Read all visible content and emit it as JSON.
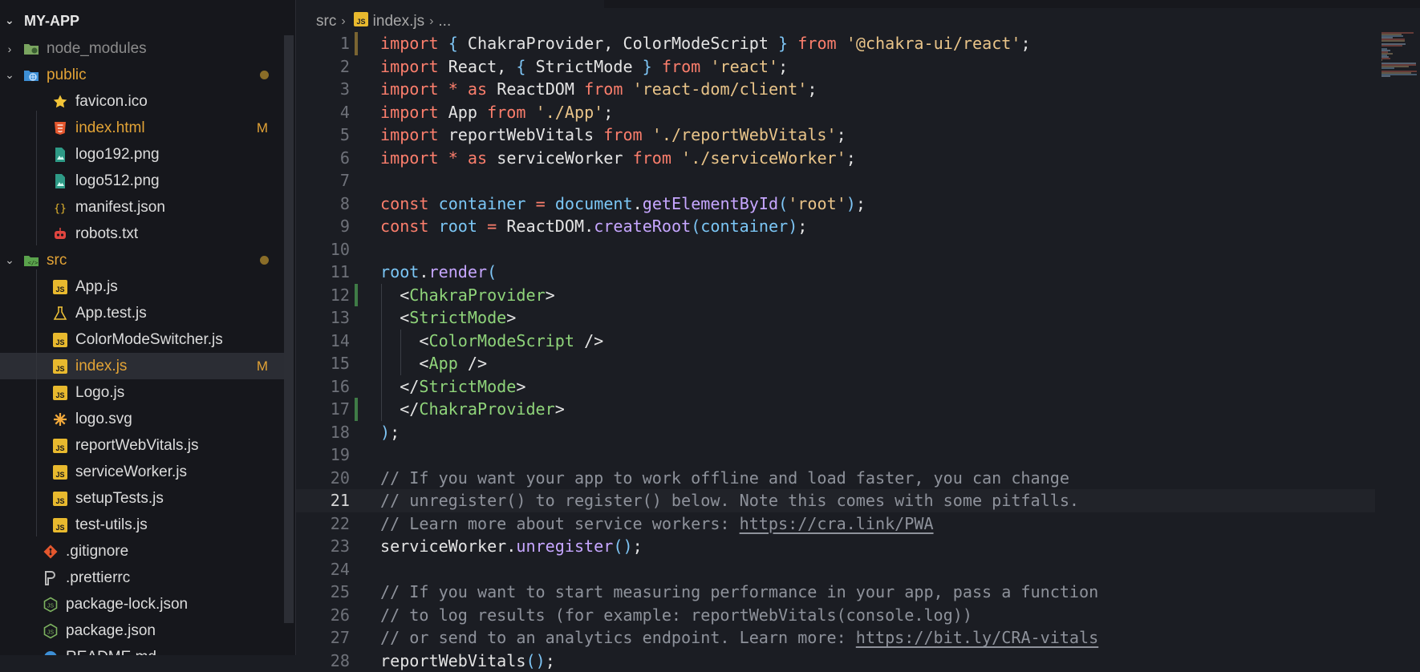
{
  "explorer": {
    "title": "MY-APP",
    "items": [
      {
        "name": "node_modules",
        "type": "folder",
        "icon": "folder-node-icon",
        "expanded": false,
        "depth": 0,
        "color": "#8c8c8c"
      },
      {
        "name": "public",
        "type": "folder",
        "icon": "folder-public-icon",
        "expanded": true,
        "depth": 0,
        "color": "#e2a336",
        "status": "dot"
      },
      {
        "name": "favicon.ico",
        "type": "file",
        "icon": "star-icon",
        "depth": 1
      },
      {
        "name": "index.html",
        "type": "file",
        "icon": "html-icon",
        "depth": 1,
        "color": "#e2a336",
        "status": "M"
      },
      {
        "name": "logo192.png",
        "type": "file",
        "icon": "image-icon",
        "depth": 1
      },
      {
        "name": "logo512.png",
        "type": "file",
        "icon": "image-icon",
        "depth": 1
      },
      {
        "name": "manifest.json",
        "type": "file",
        "icon": "json-icon",
        "depth": 1
      },
      {
        "name": "robots.txt",
        "type": "file",
        "icon": "robot-icon",
        "depth": 1
      },
      {
        "name": "src",
        "type": "folder",
        "icon": "folder-src-icon",
        "expanded": true,
        "depth": 0,
        "color": "#e2a336",
        "status": "dot"
      },
      {
        "name": "App.js",
        "type": "file",
        "icon": "js-icon",
        "depth": 1
      },
      {
        "name": "App.test.js",
        "type": "file",
        "icon": "test-flask-icon",
        "depth": 1
      },
      {
        "name": "ColorModeSwitcher.js",
        "type": "file",
        "icon": "js-icon",
        "depth": 1
      },
      {
        "name": "index.js",
        "type": "file",
        "icon": "js-icon",
        "depth": 1,
        "color": "#e2a336",
        "status": "M",
        "selected": true
      },
      {
        "name": "Logo.js",
        "type": "file",
        "icon": "js-icon",
        "depth": 1
      },
      {
        "name": "logo.svg",
        "type": "file",
        "icon": "svg-icon",
        "depth": 1
      },
      {
        "name": "reportWebVitals.js",
        "type": "file",
        "icon": "js-icon",
        "depth": 1
      },
      {
        "name": "serviceWorker.js",
        "type": "file",
        "icon": "js-icon",
        "depth": 1
      },
      {
        "name": "setupTests.js",
        "type": "file",
        "icon": "js-icon",
        "depth": 1
      },
      {
        "name": "test-utils.js",
        "type": "file",
        "icon": "js-icon",
        "depth": 1
      },
      {
        "name": ".gitignore",
        "type": "file",
        "icon": "git-icon",
        "depth": 0
      },
      {
        "name": ".prettierrc",
        "type": "file",
        "icon": "prettier-icon",
        "depth": 0
      },
      {
        "name": "package-lock.json",
        "type": "file",
        "icon": "nodejs-icon",
        "depth": 0
      },
      {
        "name": "package.json",
        "type": "file",
        "icon": "nodejs-icon",
        "depth": 0
      },
      {
        "name": "README.md",
        "type": "file",
        "icon": "info-icon",
        "depth": 0
      }
    ]
  },
  "breadcrumb": [
    "src",
    "index.js",
    "..."
  ],
  "editor": {
    "current_line": 21,
    "lines": [
      [
        [
          "k",
          "import"
        ],
        [
          "w",
          " "
        ],
        [
          "b",
          "{"
        ],
        [
          "w",
          " ChakraProvider, ColorModeScript "
        ],
        [
          "b",
          "}"
        ],
        [
          "w",
          " "
        ],
        [
          "k",
          "from"
        ],
        [
          "w",
          " "
        ],
        [
          "s",
          "'@chakra-ui/react'"
        ],
        [
          "w",
          ";"
        ]
      ],
      [
        [
          "k",
          "import"
        ],
        [
          "w",
          " React, "
        ],
        [
          "b",
          "{"
        ],
        [
          "w",
          " StrictMode "
        ],
        [
          "b",
          "}"
        ],
        [
          "w",
          " "
        ],
        [
          "k",
          "from"
        ],
        [
          "w",
          " "
        ],
        [
          "s",
          "'react'"
        ],
        [
          "w",
          ";"
        ]
      ],
      [
        [
          "k",
          "import"
        ],
        [
          "w",
          " "
        ],
        [
          "k",
          "*"
        ],
        [
          "w",
          " "
        ],
        [
          "k",
          "as"
        ],
        [
          "w",
          " ReactDOM "
        ],
        [
          "k",
          "from"
        ],
        [
          "w",
          " "
        ],
        [
          "s",
          "'react-dom/client'"
        ],
        [
          "w",
          ";"
        ]
      ],
      [
        [
          "k",
          "import"
        ],
        [
          "w",
          " App "
        ],
        [
          "k",
          "from"
        ],
        [
          "w",
          " "
        ],
        [
          "s",
          "'./App'"
        ],
        [
          "w",
          ";"
        ]
      ],
      [
        [
          "k",
          "import"
        ],
        [
          "w",
          " reportWebVitals "
        ],
        [
          "k",
          "from"
        ],
        [
          "w",
          " "
        ],
        [
          "s",
          "'./reportWebVitals'"
        ],
        [
          "w",
          ";"
        ]
      ],
      [
        [
          "k",
          "import"
        ],
        [
          "w",
          " "
        ],
        [
          "k",
          "*"
        ],
        [
          "w",
          " "
        ],
        [
          "k",
          "as"
        ],
        [
          "w",
          " serviceWorker "
        ],
        [
          "k",
          "from"
        ],
        [
          "w",
          " "
        ],
        [
          "s",
          "'./serviceWorker'"
        ],
        [
          "w",
          ";"
        ]
      ],
      [],
      [
        [
          "k",
          "const"
        ],
        [
          "w",
          " "
        ],
        [
          "v",
          "container"
        ],
        [
          "w",
          " "
        ],
        [
          "k",
          "="
        ],
        [
          "w",
          " "
        ],
        [
          "v",
          "document"
        ],
        [
          "w",
          "."
        ],
        [
          "f",
          "getElementById"
        ],
        [
          "b",
          "("
        ],
        [
          "s",
          "'root'"
        ],
        [
          "b",
          ")"
        ],
        [
          "w",
          ";"
        ]
      ],
      [
        [
          "k",
          "const"
        ],
        [
          "w",
          " "
        ],
        [
          "v",
          "root"
        ],
        [
          "w",
          " "
        ],
        [
          "k",
          "="
        ],
        [
          "w",
          " ReactDOM."
        ],
        [
          "f",
          "createRoot"
        ],
        [
          "b",
          "("
        ],
        [
          "v",
          "container"
        ],
        [
          "b",
          ")"
        ],
        [
          "w",
          ";"
        ]
      ],
      [],
      [
        [
          "v",
          "root"
        ],
        [
          "w",
          "."
        ],
        [
          "f",
          "render"
        ],
        [
          "b",
          "("
        ]
      ],
      [
        [
          "w",
          "  <"
        ],
        [
          "t",
          "ChakraProvider"
        ],
        [
          "w",
          ">"
        ]
      ],
      [
        [
          "w",
          "  <"
        ],
        [
          "t",
          "StrictMode"
        ],
        [
          "w",
          ">"
        ]
      ],
      [
        [
          "w",
          "    <"
        ],
        [
          "t",
          "ColorModeScript"
        ],
        [
          "w",
          " />"
        ]
      ],
      [
        [
          "w",
          "    <"
        ],
        [
          "t",
          "App"
        ],
        [
          "w",
          " />"
        ]
      ],
      [
        [
          "w",
          "  </"
        ],
        [
          "t",
          "StrictMode"
        ],
        [
          "w",
          ">"
        ]
      ],
      [
        [
          "w",
          "  </"
        ],
        [
          "t",
          "ChakraProvider"
        ],
        [
          "w",
          ">"
        ]
      ],
      [
        [
          "b",
          ")"
        ],
        [
          "w",
          ";"
        ]
      ],
      [],
      [
        [
          "c",
          "// If you want your app to work offline and load faster, you can change"
        ]
      ],
      [
        [
          "c",
          "// unregister() to register() below. Note this comes with some pitfalls."
        ]
      ],
      [
        [
          "c",
          "// Learn more about service workers: "
        ],
        [
          "u",
          "https://cra.link/PWA"
        ]
      ],
      [
        [
          "w",
          "serviceWorker."
        ],
        [
          "f",
          "unregister"
        ],
        [
          "b",
          "("
        ],
        [
          "b",
          ")"
        ],
        [
          "w",
          ";"
        ]
      ],
      [],
      [
        [
          "c",
          "// If you want to start measuring performance in your app, pass a function"
        ]
      ],
      [
        [
          "c",
          "// to log results (for example: reportWebVitals(console.log))"
        ]
      ],
      [
        [
          "c",
          "// or send to an analytics endpoint. Learn more: "
        ],
        [
          "u",
          "https://bit.ly/CRA-vitals"
        ]
      ],
      [
        [
          "w",
          "reportWebVitals"
        ],
        [
          "b",
          "("
        ],
        [
          "b",
          ")"
        ],
        [
          "w",
          ";"
        ]
      ]
    ]
  },
  "colors": {
    "modified": "#e2a336",
    "keyword": "#fb7e6c",
    "string": "#e9c489",
    "jsx_tag": "#8fd47a",
    "gutter_added": "#3f7b46",
    "gutter_modified": "#7a6432"
  }
}
